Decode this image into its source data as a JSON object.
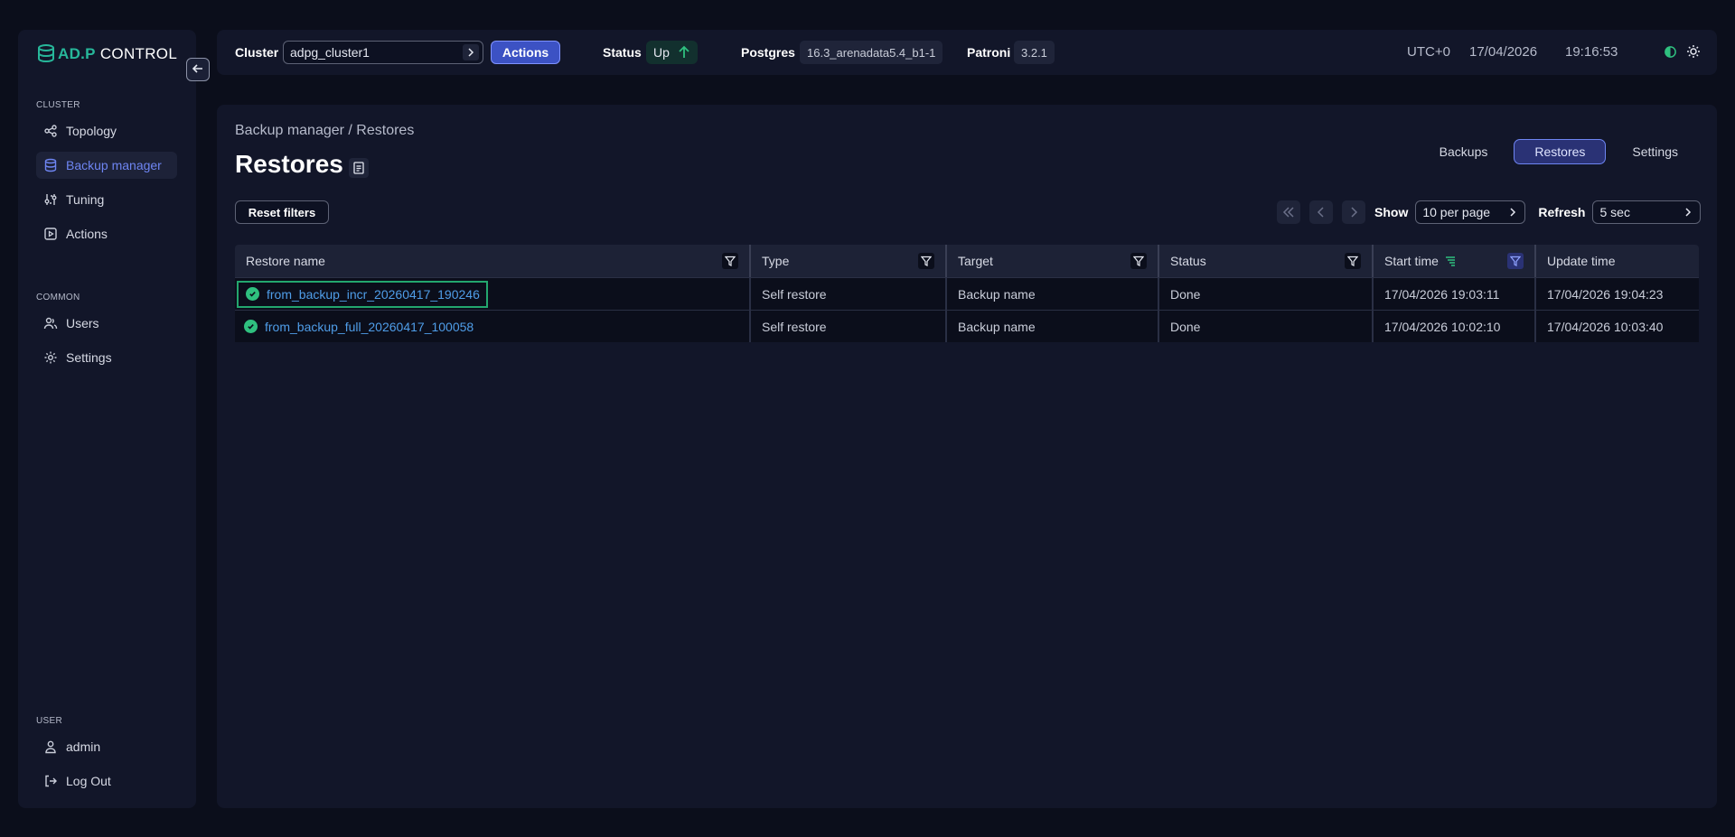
{
  "app": {
    "logo_adp": "AD.P",
    "logo_control": "CONTROL"
  },
  "sidebar": {
    "cluster_section": "CLUSTER",
    "cluster_items": [
      {
        "label": "Topology",
        "icon": "topology-icon"
      },
      {
        "label": "Backup manager",
        "icon": "database-icon",
        "active": true
      },
      {
        "label": "Tuning",
        "icon": "sliders-icon"
      },
      {
        "label": "Actions",
        "icon": "play-icon"
      }
    ],
    "common_section": "COMMON",
    "common_items": [
      {
        "label": "Users",
        "icon": "users-icon"
      },
      {
        "label": "Settings",
        "icon": "gear-icon"
      }
    ],
    "user_section": "USER",
    "user_items": [
      {
        "label": "admin",
        "icon": "user-icon"
      },
      {
        "label": "Log Out",
        "icon": "logout-icon"
      }
    ]
  },
  "topbar": {
    "cluster_label": "Cluster",
    "cluster_value": "adpg_cluster1",
    "actions_label": "Actions",
    "status_label": "Status",
    "status_value": "Up",
    "postgres_label": "Postgres",
    "postgres_value": "16.3_arenadata5.4_b1-1",
    "patroni_label": "Patroni",
    "patroni_value": "3.2.1",
    "timezone": "UTC+0",
    "date": "17/04/2026",
    "time": "19:16:53"
  },
  "page": {
    "breadcrumb": "Backup manager / Restores",
    "title": "Restores",
    "tabs": [
      {
        "label": "Backups",
        "active": false
      },
      {
        "label": "Restores",
        "active": true
      },
      {
        "label": "Settings",
        "active": false
      }
    ],
    "reset_filters": "Reset filters",
    "show_label": "Show",
    "show_value": "10 per page",
    "refresh_label": "Refresh",
    "refresh_value": "5 sec"
  },
  "table": {
    "columns": [
      "Restore name",
      "Type",
      "Target",
      "Status",
      "Start time",
      "Update time"
    ],
    "rows": [
      {
        "name": "from_backup_incr_20260417_190246",
        "type": "Self restore",
        "target": "Backup name",
        "status": "Done",
        "start": "17/04/2026 19:03:11",
        "update": "17/04/2026 19:04:23"
      },
      {
        "name": "from_backup_full_20260417_100058",
        "type": "Self restore",
        "target": "Backup name",
        "status": "Done",
        "start": "17/04/2026 10:02:10",
        "update": "17/04/2026 10:03:40"
      }
    ]
  },
  "colors": {
    "accent": "#6e85f2",
    "brand": "#27b79a",
    "success": "#2fc07f",
    "link": "#4f9de8"
  }
}
